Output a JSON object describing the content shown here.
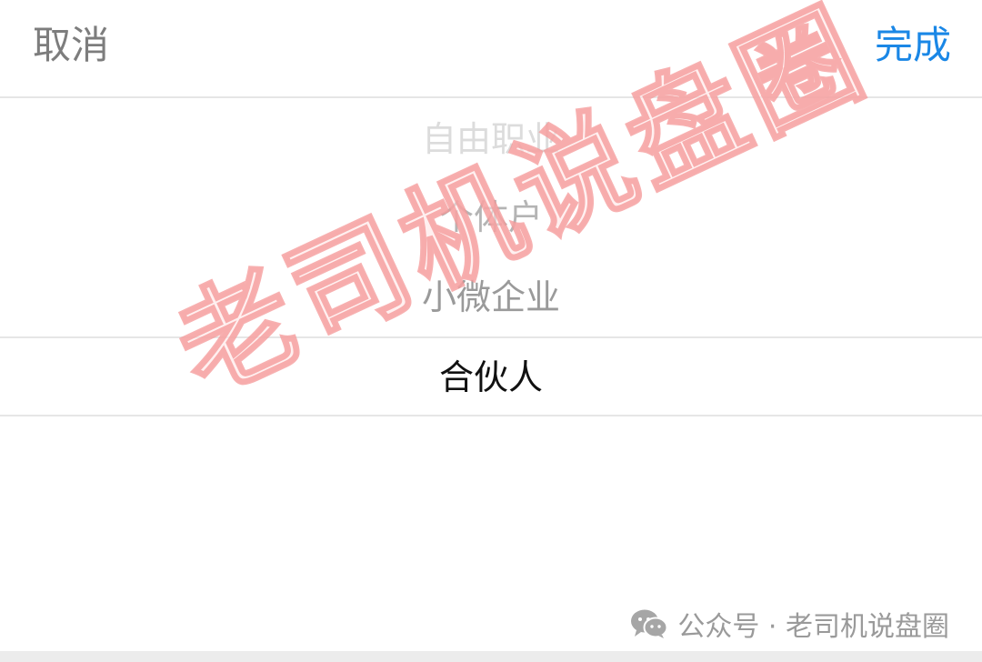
{
  "toolbar": {
    "cancel_label": "取消",
    "done_label": "完成"
  },
  "picker": {
    "options": [
      "自由职业",
      "个体户",
      "小微企业",
      "合伙人"
    ],
    "selected": "合伙人"
  },
  "watermark": {
    "text": "老司机说盘圈"
  },
  "footer": {
    "icon": "wechat-icon",
    "text": "公众号 · 老司机说盘圈"
  },
  "colors": {
    "accent": "#1a87e6",
    "cancel": "#7d7d7d",
    "watermark": "#f49696"
  }
}
